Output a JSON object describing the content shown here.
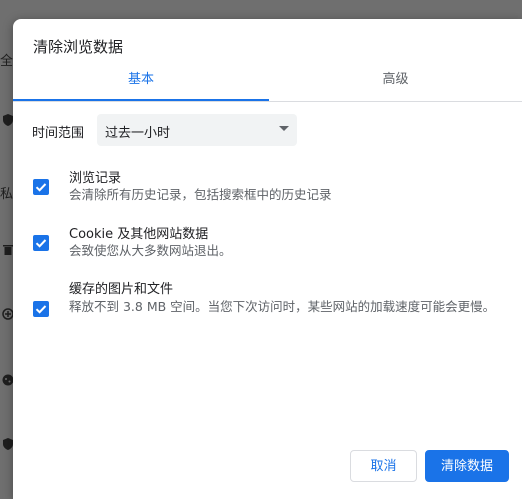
{
  "background": {
    "fragments": [
      "全",
      "私"
    ],
    "icons": [
      "shield-icon",
      "trash-icon",
      "add-circle-icon",
      "cookie-icon",
      "shield-icon"
    ]
  },
  "dialog": {
    "title": "清除浏览数据",
    "tabs": [
      {
        "label": "基本",
        "selected": true
      },
      {
        "label": "高级",
        "selected": false
      }
    ],
    "time_range": {
      "label": "时间范围",
      "value": "过去一小时"
    },
    "options": [
      {
        "title": "浏览记录",
        "description": "会清除所有历史记录，包括搜索框中的历史记录",
        "checked": true
      },
      {
        "title": "Cookie 及其他网站数据",
        "description": "会致使您从大多数网站退出。",
        "checked": true
      },
      {
        "title": "缓存的图片和文件",
        "description": "释放不到 3.8 MB 空间。当您下次访问时，某些网站的加载速度可能会更慢。",
        "checked": true
      }
    ],
    "buttons": {
      "cancel": "取消",
      "clear": "清除数据"
    }
  },
  "colors": {
    "accent": "#1a73e8",
    "overlay": "#6e6e6e"
  }
}
